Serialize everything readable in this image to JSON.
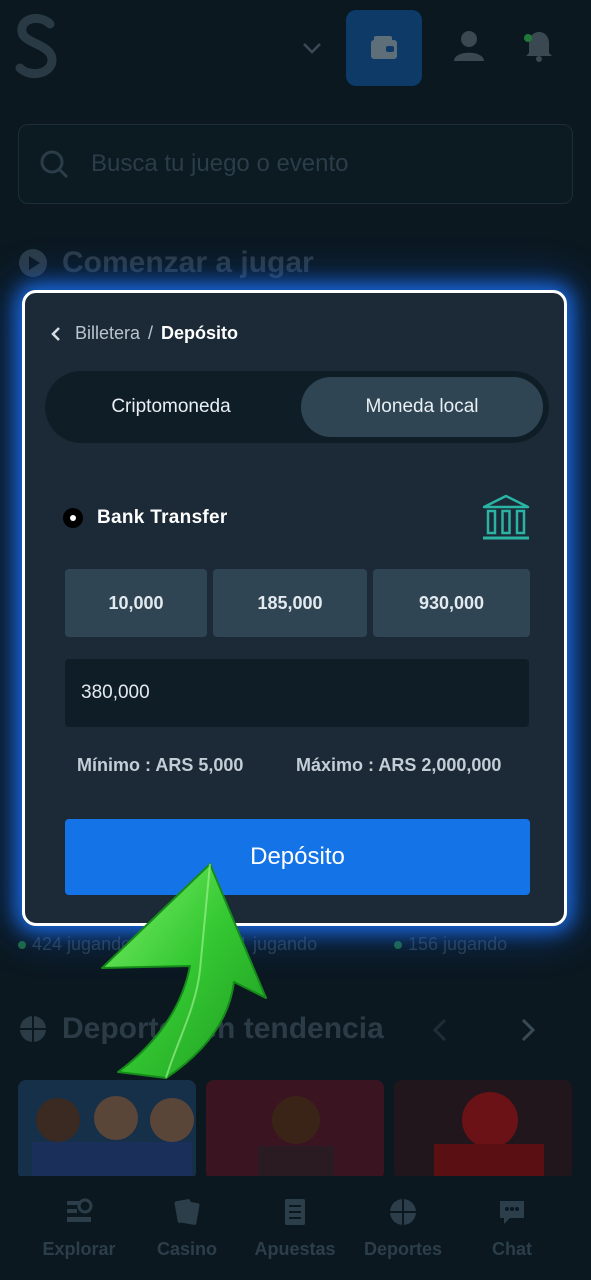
{
  "background": {
    "search_placeholder": "Busca tu juego o evento",
    "section_start_title": "Comenzar a jugar",
    "playing_counts": [
      "424 jugando",
      "1 jugando",
      "156 jugando"
    ],
    "section_trending_title": "Deportes en tendencia",
    "bottom_nav": [
      {
        "label": "Explorar",
        "icon": "explore-icon"
      },
      {
        "label": "Casino",
        "icon": "cards-icon"
      },
      {
        "label": "Apuestas",
        "icon": "betslip-icon"
      },
      {
        "label": "Deportes",
        "icon": "basketball-icon"
      },
      {
        "label": "Chat",
        "icon": "chat-icon"
      }
    ]
  },
  "modal": {
    "breadcrumb": {
      "parent": "Billetera",
      "separator": "/",
      "current": "Depósito"
    },
    "tabs": {
      "crypto": "Criptomoneda",
      "local": "Moneda local",
      "active": "local"
    },
    "method": {
      "label": "Bank Transfer",
      "icon": "bank-icon",
      "selected": true
    },
    "preset_amounts": [
      "10,000",
      "185,000",
      "930,000"
    ],
    "amount_value": "380,000",
    "limits": {
      "min": "Mínimo : ARS 5,000",
      "max": "Máximo : ARS 2,000,000"
    },
    "deposit_button": "Depósito"
  },
  "colors": {
    "accent": "#1473e6",
    "modal_bg": "#1b2a36",
    "glow": "#1e78ff",
    "arrow": "#3fce3f",
    "bank_icon": "#2bb3a3"
  }
}
